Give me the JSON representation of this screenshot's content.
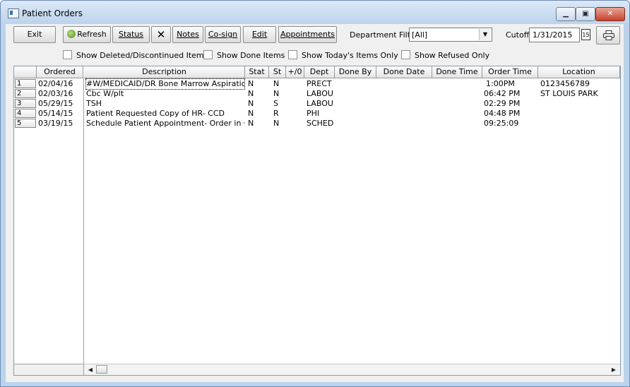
{
  "window": {
    "title": "Patient Orders"
  },
  "toolbar": {
    "exit": "Exit",
    "refresh": "Refresh",
    "status": "Status",
    "delete": "✕",
    "notes": "Notes",
    "cosign": "Co-sign",
    "edit": "Edit",
    "appointments": "Appointments",
    "department_filter_label": "Department Filter",
    "department_filter_value": "[All]",
    "cutoff_label": "Cutoff",
    "cutoff_value": "1/31/2015",
    "calendar_icon_text": "15"
  },
  "filters": [
    {
      "label": "Show Deleted/Discontinued Items",
      "checked": false
    },
    {
      "label": "Show Done Items",
      "checked": false
    },
    {
      "label": "Show Today's Items Only",
      "checked": false
    },
    {
      "label": "Show Refused Only",
      "checked": false
    }
  ],
  "table": {
    "columns": [
      "Ordered",
      "Description",
      "Stat",
      "St",
      "+/0",
      "Dept",
      "Done By",
      "Done Date",
      "Done Time",
      "Order Time",
      "Location"
    ],
    "rows": [
      {
        "num": "1",
        "ordered": "02/04/16",
        "description": "#W/MEDICAID/DR Bone Marrow Aspiration &-",
        "stat": "N",
        "st": "N",
        "plus": "",
        "dept": "PRECT",
        "done_by": "",
        "done_date": "",
        "done_time": "",
        "order_time": "1:00PM",
        "location": "0123456789"
      },
      {
        "num": "2",
        "ordered": "02/03/16",
        "description": "Cbc W/plt",
        "stat": "N",
        "st": "N",
        "plus": "",
        "dept": "LABOU",
        "done_by": "",
        "done_date": "",
        "done_time": "",
        "order_time": "06:42 PM",
        "location": "ST LOUIS PARK"
      },
      {
        "num": "3",
        "ordered": "05/29/15",
        "description": "TSH",
        "stat": "N",
        "st": "S",
        "plus": "",
        "dept": "LABOU",
        "done_by": "",
        "done_date": "",
        "done_time": "",
        "order_time": "02:29 PM",
        "location": ""
      },
      {
        "num": "4",
        "ordered": "05/14/15",
        "description": "Patient Requested Copy of HR- CCD",
        "stat": "N",
        "st": "R",
        "plus": "",
        "dept": "PHI",
        "done_by": "",
        "done_date": "",
        "done_time": "",
        "order_time": "04:48 PM",
        "location": ""
      },
      {
        "num": "5",
        "ordered": "03/19/15",
        "description": "Schedule Patient Appointment- Order in Chart",
        "stat": "N",
        "st": "N",
        "plus": "",
        "dept": "SCHED",
        "done_by": "",
        "done_date": "",
        "done_time": "",
        "order_time": "09:25:09",
        "location": ""
      }
    ]
  },
  "colors": {
    "title_bar": "#bcd3ec",
    "client_bg": "#f0f0f0",
    "close_button": "#c4432c"
  }
}
